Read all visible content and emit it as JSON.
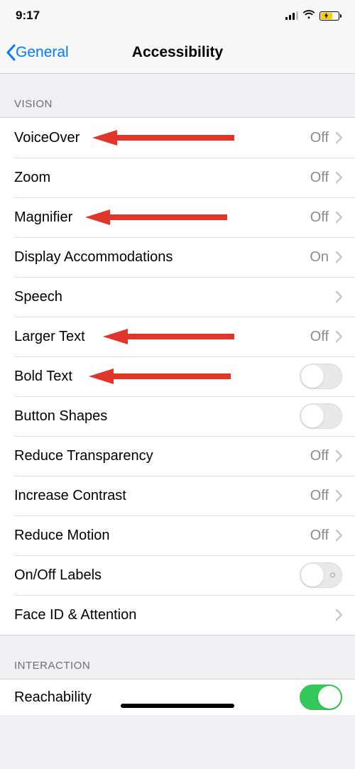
{
  "status": {
    "time": "9:17"
  },
  "nav": {
    "back": "General",
    "title": "Accessibility"
  },
  "sections": {
    "vision": {
      "header": "VISION",
      "voiceover": {
        "label": "VoiceOver",
        "value": "Off"
      },
      "zoom": {
        "label": "Zoom",
        "value": "Off"
      },
      "magnifier": {
        "label": "Magnifier",
        "value": "Off"
      },
      "display": {
        "label": "Display Accommodations",
        "value": "On"
      },
      "speech": {
        "label": "Speech"
      },
      "largertext": {
        "label": "Larger Text",
        "value": "Off"
      },
      "boldtext": {
        "label": "Bold Text"
      },
      "buttonshapes": {
        "label": "Button Shapes"
      },
      "reducetrans": {
        "label": "Reduce Transparency",
        "value": "Off"
      },
      "increasecon": {
        "label": "Increase Contrast",
        "value": "Off"
      },
      "reducemotion": {
        "label": "Reduce Motion",
        "value": "Off"
      },
      "onofflabels": {
        "label": "On/Off Labels"
      },
      "faceid": {
        "label": "Face ID & Attention"
      }
    },
    "interaction": {
      "header": "INTERACTION",
      "reachability": {
        "label": "Reachability"
      }
    }
  },
  "annotations": {
    "arrow_color": "#e0352b"
  }
}
